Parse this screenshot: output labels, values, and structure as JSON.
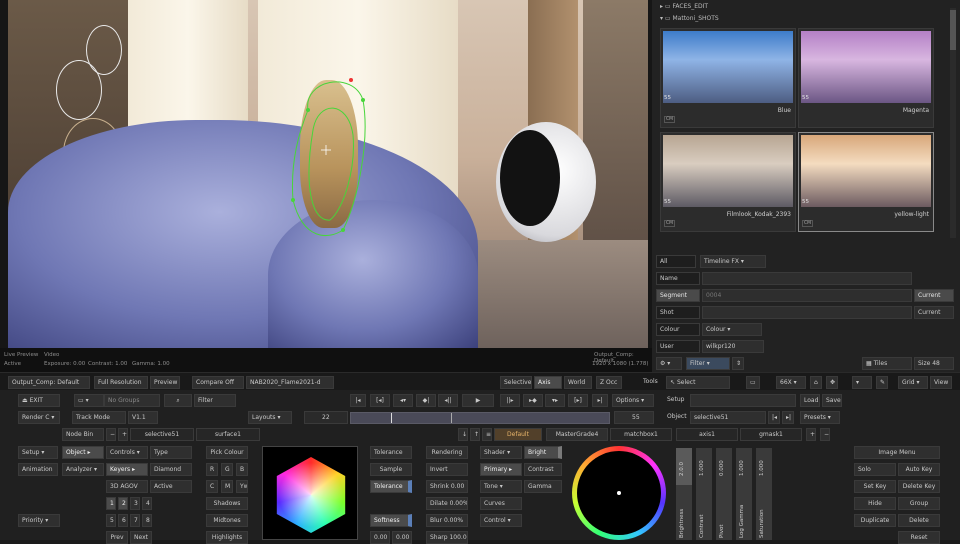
{
  "viewer": {
    "tab": "gmask1",
    "status": {
      "left1": "Live Preview",
      "left1b": "Video",
      "left2": "Active",
      "exposure": "Exposure: 0.00",
      "contrast": "Contrast: 1.00",
      "gamma": "Gamma: 1.00",
      "right1": "Output_Comp: Default",
      "right2": "1920 x 1080 (1.778)"
    }
  },
  "library": {
    "tree": [
      "FACES_EDIT",
      "Mattoni_SHOTS"
    ],
    "thumbs": [
      {
        "label": "Blue",
        "num": "55",
        "cm": "CM"
      },
      {
        "label": "Magenta",
        "num": "55",
        "cm": ""
      },
      {
        "label": "Filmlook_Kodak_2393",
        "num": "55",
        "cm": "CM"
      },
      {
        "label": "yellow-light",
        "num": "55",
        "cm": "CM"
      }
    ]
  },
  "props": {
    "all": "All",
    "timeline_fx": "Timeline FX",
    "name": "Name",
    "segment": "Segment",
    "segment_val": "0004",
    "current1": "Current",
    "shot": "Shot",
    "current2": "Current",
    "colour": "Colour",
    "colour_val": "Colour",
    "user": "User",
    "user_val": "wilkpr120",
    "filter": "Filter",
    "tiles": "Tiles",
    "size": "Size 48"
  },
  "toolbar": {
    "output": "Output_Comp: Default",
    "resolution": "Full Resolution",
    "preview": "Preview",
    "compare": "Compare Off",
    "clip": "NAB2020_Flame2021-d",
    "selective": "Selective",
    "axis": "Axis",
    "world": "World",
    "zocc": "Z Occ",
    "tools": "Tools",
    "select": "Select",
    "zoom": "66X",
    "grid": "Grid",
    "view": "View"
  },
  "panel": {
    "exit": "EXIT",
    "no_groups": "No Groups",
    "filter": "Filter",
    "render": "Render C",
    "track_mode": "Track Mode",
    "v11": "V1.1",
    "layouts": "Layouts",
    "frame": "22",
    "frame_end": "55",
    "options": "Options",
    "setup_label": "Setup",
    "load": "Load",
    "save": "Save",
    "node_bin": "Node Bin",
    "selective51": "selective51",
    "surface1": "surface1",
    "object_label": "Object",
    "object_val": "selective51",
    "presets": "Presets",
    "tabs": [
      "Default",
      "MasterGrade4",
      "matchbox1",
      "axis1",
      "gmask1"
    ],
    "setup": "Setup",
    "object": "Object",
    "controls": "Controls",
    "type": "Type",
    "animation": "Animation",
    "analyzer": "Analyzer",
    "keyers": "Keyers",
    "diamond": "Diamond",
    "agov": "3D AGOV",
    "active": "Active",
    "nums1": [
      "1",
      "2",
      "3",
      "4"
    ],
    "nums2": [
      "5",
      "6",
      "7",
      "8"
    ],
    "priority": "Priority",
    "prev": "Prev",
    "next": "Next",
    "pick_colour": "Pick Colour",
    "rgb": [
      "R",
      "G",
      "B"
    ],
    "cmy": [
      "C",
      "M",
      "Yw"
    ],
    "shadows": "Shadows",
    "midtones": "Midtones",
    "highlights": "Highlights",
    "tolerance": "Tolerance",
    "sample": "Sample",
    "tolerance2": "Tolerance",
    "softness": "Softness",
    "val0": "0.00",
    "val1": "0.00",
    "rendering": "Rendering",
    "invert": "Invert",
    "shrink": "Shrink 0.00",
    "dilate": "Dilate 0.00%",
    "blur": "Blur 0.00%",
    "sharp": "Sharp 100.0",
    "shader": "Shader",
    "bright": "Bright",
    "primary": "Primary",
    "contrast": "Contrast",
    "tone": "Tone",
    "gamma": "Gamma",
    "curves": "Curves",
    "control": "Control",
    "sliders": [
      {
        "name": "Brightness",
        "val": "2.0.0"
      },
      {
        "name": "Contrast",
        "val": "1.000"
      },
      {
        "name": "Pivot",
        "val": "0.000"
      },
      {
        "name": "Log Gamma",
        "val": "1.000"
      },
      {
        "name": "Saturation",
        "val": "1.000"
      }
    ],
    "image_menu": "Image Menu",
    "solo": "Solo",
    "auto_key": "Auto Key",
    "set_key": "Set Key",
    "delete_key": "Delete Key",
    "hide": "Hide",
    "group": "Group",
    "duplicate": "Duplicate",
    "delete": "Delete",
    "reset": "Reset"
  },
  "colors": {
    "accent": "#e6b36a",
    "panel": "#202020",
    "field": "#2e2e2e"
  }
}
